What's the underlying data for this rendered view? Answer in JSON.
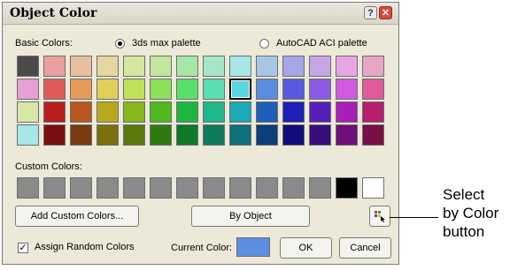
{
  "dialog": {
    "title": "Object Color",
    "help_glyph": "?",
    "close_glyph": "✕"
  },
  "basic": {
    "label": "Basic Colors:",
    "palette_3ds": "3ds max palette",
    "palette_aci": "AutoCAD ACI palette",
    "selected_palette": "3ds max palette",
    "selected_swatch": {
      "row": 1,
      "col": 8
    },
    "rows": [
      [
        "#4a4a4a",
        "#e8a0a0",
        "#e8c0a0",
        "#e6d6a0",
        "#d6e6a0",
        "#c0e6a0",
        "#a6e6a6",
        "#a6e6c6",
        "#a6e6e6",
        "#a6c6e6",
        "#a6a6e6",
        "#c6a6e6",
        "#e6a6e6",
        "#e6a6c6"
      ],
      [
        "#e6a0d6",
        "#e05a5a",
        "#e89a5a",
        "#e0d05a",
        "#bfe05a",
        "#8ce05a",
        "#5ae06a",
        "#5ae0b0",
        "#5ad6e0",
        "#5a8ce0",
        "#5a5ae0",
        "#8c5ae0",
        "#d05ae0",
        "#e05a9a"
      ],
      [
        "#d8e6a6",
        "#b81e1e",
        "#b8581e",
        "#b8a81e",
        "#88b81e",
        "#4eb81e",
        "#1eb83e",
        "#1eb88a",
        "#1ea8b8",
        "#1e5eb8",
        "#1e1eb8",
        "#581eb8",
        "#a81eb8",
        "#b81e6e"
      ],
      [
        "#a6e6e6",
        "#7a0e0e",
        "#7a3a0e",
        "#7a700e",
        "#5a7a0e",
        "#2e7a0e",
        "#0e7a2a",
        "#0e7a5c",
        "#0e707a",
        "#0e3e7a",
        "#0e0e7a",
        "#3a0e7a",
        "#700e7a",
        "#7a0e46"
      ]
    ]
  },
  "custom": {
    "label": "Custom Colors:",
    "swatches": [
      "#8a8a8a",
      "#8a8a8a",
      "#8a8a8a",
      "#8a8a8a",
      "#8a8a8a",
      "#8a8a8a",
      "#8a8a8a",
      "#8a8a8a",
      "#8a8a8a",
      "#8a8a8a",
      "#8a8a8a",
      "#8a8a8a",
      "#000000",
      "#ffffff"
    ]
  },
  "buttons": {
    "add_custom": "Add Custom Colors...",
    "by_object": "By Object",
    "ok": "OK",
    "cancel": "Cancel"
  },
  "footer": {
    "assign_random": "Assign Random Colors",
    "assign_random_checked": true,
    "current_color_label": "Current Color:",
    "current_color": "#5b8ee0"
  },
  "annotation": {
    "line1": "Select",
    "line2": "by Color",
    "line3": "button"
  }
}
